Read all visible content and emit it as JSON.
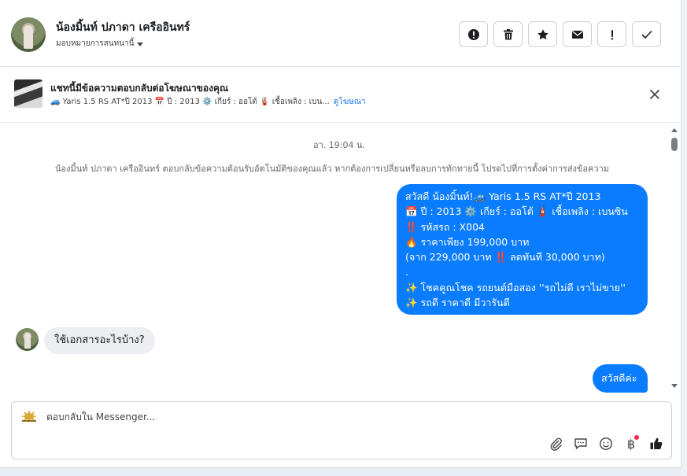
{
  "header": {
    "contact_name": "น้องมิ้นท์ ปภาดา เครืออินทร์",
    "assign_label": "มอบหมายการสนทนานี้",
    "actions": [
      {
        "icon": "alert-circle-icon"
      },
      {
        "icon": "trash-icon"
      },
      {
        "icon": "star-icon"
      },
      {
        "icon": "mail-icon"
      },
      {
        "icon": "exclamation-icon"
      },
      {
        "icon": "checkmark-icon"
      }
    ]
  },
  "ad_banner": {
    "title": "แชทนี้มีข้อความตอบกลับต่อโฆษณาของคุณ",
    "subtitle": "🚙 Yaris 1.5 RS AT*ปี 2013 📅 ปี : 2013 ⚙️ เกียร์ : ออโต้ 🧯 เชื้อเพลิง : เบน...",
    "link": "ดูโฆษณา"
  },
  "conversation": {
    "timestamp": "อา. 19:04 น.",
    "system_message": "น้องมิ้นท์ ปภาดา เครืออินทร์ ตอบกลับข้อความต้อนรับอัตโนมัติของคุณแล้ว หากต้องการเปลี่ยนหรือลบการทักทายนี้ โปรดไปที่การตั้งค่าการส่งข้อความ",
    "outgoing_welcome": [
      "สวัสดี น้องมิ้นท์!🚙 Yaris 1.5 RS AT*ปี 2013",
      "📅 ปี : 2013 ⚙️ เกียร์ : ออโต้ 🧯 เชื้อเพลิง : เบนซิน",
      "‼️ รหัสรถ : X004",
      "🔥 ราคาเพียง 199,000 บาท",
      "(จาก 229,000 บาท ‼️ ลดทันที 30,000 บาท)",
      ".",
      "✨ โชคคูณโชค รถยนต์มือสอง ''รถไม่ดี เราไม่ขาย''",
      "✨ รถดี ราคาดี มีวารันตี"
    ],
    "incoming_message": "ใช้เอกสารอะไรบ้าง?",
    "outgoing_reply": "สวัสดีค่ะ"
  },
  "composer": {
    "placeholder": "ตอบกลับใน Messenger...",
    "tools": [
      "paperclip-icon",
      "saved-reply-icon",
      "emoji-icon",
      "baht-icon",
      "thumbs-up-icon"
    ],
    "baht_symbol": "฿"
  },
  "colors": {
    "accent": "#0a7cff",
    "link": "#1877f2",
    "incoming_bubble": "#eceef1",
    "notification_dot": "#f02849"
  }
}
